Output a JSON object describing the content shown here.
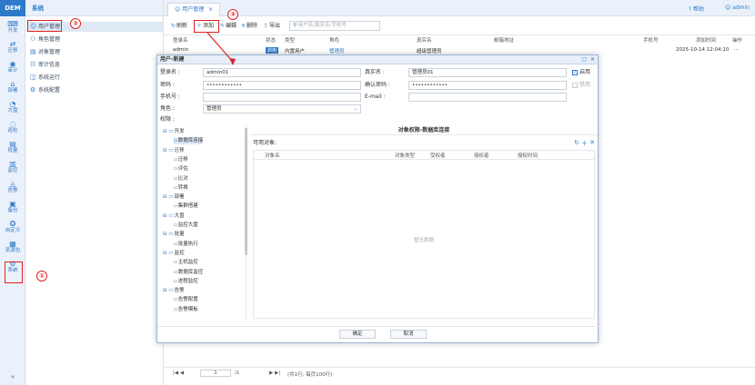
{
  "app": {
    "logo": "DEM",
    "section_title": "系统",
    "help": "帮助",
    "user": "admin"
  },
  "rail": [
    {
      "label": "开发",
      "icon": "code-icon"
    },
    {
      "label": "迁移",
      "icon": "migrate-icon"
    },
    {
      "label": "审计",
      "icon": "audit-icon"
    },
    {
      "label": "部署",
      "icon": "deploy-icon"
    },
    {
      "label": "大盘",
      "icon": "dashboard-icon"
    },
    {
      "label": "巡检",
      "icon": "inspect-icon"
    },
    {
      "label": "批量",
      "icon": "batch-icon"
    },
    {
      "label": "监控",
      "icon": "monitor-icon"
    },
    {
      "label": "告警",
      "icon": "alarm-icon"
    },
    {
      "label": "备份",
      "icon": "backup-icon"
    },
    {
      "label": "自定义",
      "icon": "custom-icon"
    },
    {
      "label": "资源包",
      "icon": "package-icon"
    },
    {
      "label": "系统",
      "icon": "gear-icon"
    }
  ],
  "rail_collapse": "«",
  "nav": [
    "用户管理",
    "角色管理",
    "对象管理",
    "审计信息",
    "系统运行",
    "系统配置"
  ],
  "tab": {
    "label": "用户管理",
    "close": "×"
  },
  "toolbar": {
    "refresh": "刷新",
    "add": "添加",
    "edit": "编辑",
    "delete": "删除",
    "export": "导出",
    "search_placeholder": "用户名/真实名/手机号"
  },
  "grid": {
    "headers": [
      "登录名",
      "状态",
      "类型",
      "角色",
      "真实名",
      "邮箱地址",
      "手机号",
      "添加时间",
      "操作"
    ],
    "row": {
      "login": "admin",
      "status": "启用",
      "type": "内置用户",
      "role": "管理员",
      "realname": "超级管理员",
      "time": "2025-10-14 12:04:10",
      "more": "···"
    }
  },
  "pager": {
    "page": "1",
    "of": "/1",
    "summary": "(共1行, 每页100行)"
  },
  "dialog": {
    "title": "用户-新建",
    "login_label": "登录名 :",
    "login_value": "admin01",
    "real_label": "真实名 :",
    "real_value": "管理员01",
    "pwd_label": "密码 :",
    "pwd_value": "••••••••••••",
    "pwd2_label": "确认密码 :",
    "pwd2_value": "••••••••••••",
    "phone_label": "手机号 :",
    "email_label": "E-mail :",
    "role_label": "角色 :",
    "role_value": "管理员",
    "perm_label": "权限 :",
    "enable": "启用",
    "disable": "禁用",
    "perm_title": "对象权限-数据库连接",
    "assignable": "可用对象:",
    "cols": [
      "对象名",
      "对象类型",
      "受权者",
      "授权者",
      "授权时间"
    ],
    "empty": "暂无数据",
    "ok": "确定",
    "cancel": "取消"
  },
  "tree": [
    {
      "label": "开发",
      "level": 0
    },
    {
      "label": "数据库连接",
      "level": 1
    },
    {
      "label": "迁移",
      "level": 0
    },
    {
      "label": "迁移",
      "level": 1
    },
    {
      "label": "评估",
      "level": 1
    },
    {
      "label": "比对",
      "level": 1
    },
    {
      "label": "转换",
      "level": 1
    },
    {
      "label": "部署",
      "level": 0
    },
    {
      "label": "集群搭建",
      "level": 1
    },
    {
      "label": "大盘",
      "level": 0
    },
    {
      "label": "监控大盘",
      "level": 1
    },
    {
      "label": "批量",
      "level": 0
    },
    {
      "label": "批量执行",
      "level": 1
    },
    {
      "label": "监控",
      "level": 0
    },
    {
      "label": "主机监控",
      "level": 1
    },
    {
      "label": "数据库监控",
      "level": 1
    },
    {
      "label": "进程监控",
      "level": 1
    },
    {
      "label": "告警",
      "level": 0
    },
    {
      "label": "告警配置",
      "level": 1
    },
    {
      "label": "告警模板",
      "level": 1
    }
  ],
  "annotations": [
    "①",
    "②",
    "③"
  ]
}
